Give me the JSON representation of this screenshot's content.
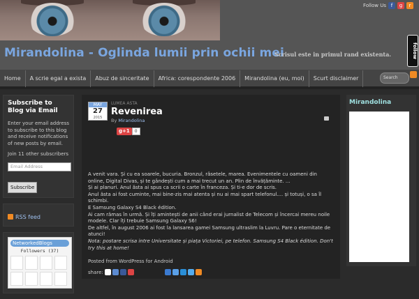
{
  "header": {
    "follow_label": "Follow Us",
    "site_title": "Mirandolina - Oglinda lumii prin ochii mei",
    "tagline": "Scrisul este in primul rand existenta.",
    "follow_tab": "follow"
  },
  "nav": {
    "items": [
      "Home",
      "A scrie egal a exista",
      "Abuz de sinceritate",
      "Africa: corespondente 2006",
      "Mirandolina (eu, moi)",
      "Scurt disclaimer"
    ],
    "search_placeholder": "Search"
  },
  "left": {
    "subscribe_title": "Subscribe to Blog via Email",
    "subscribe_text": "Enter your email address to subscribe to this blog and receive notifications of new posts by email.",
    "subscribers": "Join 11 other subscribers",
    "email_placeholder": "Email Address",
    "subscribe_button": "Subscribe",
    "rss": "RSS feed",
    "networked": "NetworkedBlogs",
    "followers": "Followers (37)"
  },
  "post": {
    "month": "MAY",
    "day": "27",
    "year": "2015",
    "category": "LUMEA ASTA",
    "title": "Revenirea",
    "by": "By",
    "author": "Mirandolina",
    "gplus": "g+1",
    "gplus_count": "0",
    "paragraphs": [
      "A venit vara. Și cu ea soarele,  bucuria. Bronzul, râsetele,  marea. Evenimentele cu oameni din online, Digital Divas, și te gândești cum a mai trecut  un an. Plin de învățăminte. ...",
      "Și ai planuri. Anul ăsta ai spus ca scrii o carte în franceza. Și ti-e dor de scris.",
      "Anul ăsta ai fost cuminte, mai bine-zis mai atenta și nu ai mai spart telefonul.... și totuși,  o sa îl schimbi.",
      "E Samsung  Galaxy S4 Black  édition.",
      "Ai cam rămas în urmă. Și îți amintești de anii când erai jurnalist de Telecom și încercai mereu noile modele. Clar îți trebuie Samsung  Galaxy S6!",
      "De altfel, în august 2006 ai fost la lansarea gamei Samsung ultraslim la Luvru.   Pare o eternitate  de atunci!"
    ],
    "note": "Nota: postare scrisa intre Universitate și piața Victoriei, pe telefon. Samsung S4 Black édition. Don't try this at home!",
    "posted_from": "Posted from WordPress for Android",
    "share_label": "share:"
  },
  "right": {
    "title": "Mirandolina"
  },
  "colors": {
    "title_blue": "#7aa6e0",
    "rss_orange": "#f08a24",
    "gplus_red": "#dd4444"
  }
}
